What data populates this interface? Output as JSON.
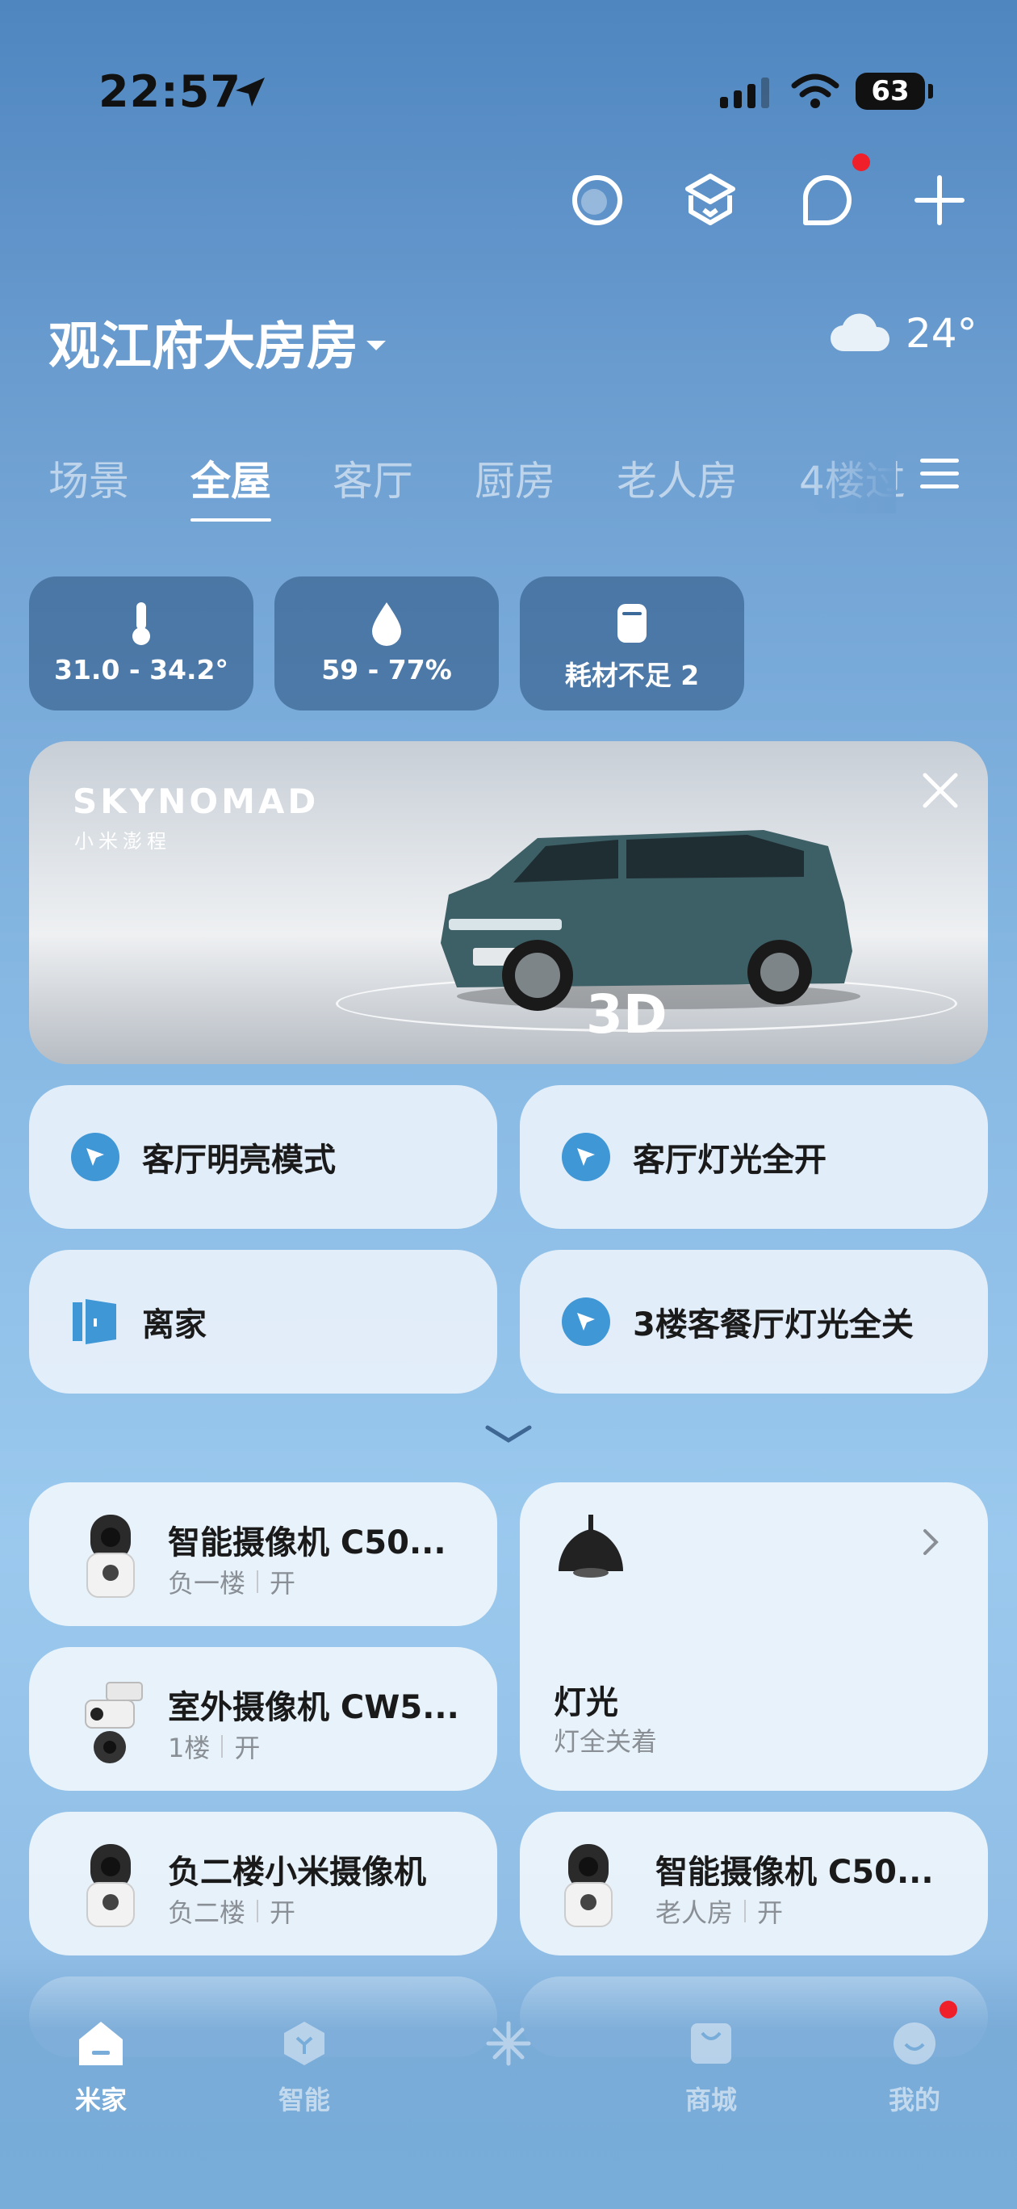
{
  "status_bar": {
    "time": "22:57",
    "battery": "63"
  },
  "header": {
    "home_name": "观江府大房房",
    "weather_temp": "24°"
  },
  "tabs": [
    {
      "label": "场景",
      "active": false
    },
    {
      "label": "全屋",
      "active": true
    },
    {
      "label": "客厅",
      "active": false
    },
    {
      "label": "厨房",
      "active": false
    },
    {
      "label": "老人房",
      "active": false
    },
    {
      "label": "4楼过",
      "active": false
    }
  ],
  "stats": [
    {
      "icon": "thermometer-icon",
      "value": "31.0 - 34.2°"
    },
    {
      "icon": "humidity-drop-icon",
      "value": "59 - 77%"
    },
    {
      "icon": "consumable-icon",
      "value": "耗材不足 2"
    }
  ],
  "banner": {
    "brand": "SKYNOMAD",
    "subtitle": "小米澎程",
    "badge": "3D"
  },
  "scenes": [
    {
      "label": "客厅明亮模式",
      "icon": "cursor-click-icon"
    },
    {
      "label": "客厅灯光全开",
      "icon": "cursor-click-icon"
    },
    {
      "label": "离家",
      "icon": "door-icon"
    },
    {
      "label": "3楼客餐厅灯光全关",
      "icon": "cursor-click-icon"
    }
  ],
  "devices": [
    {
      "name": "智能摄像机 C50...",
      "room": "负一楼",
      "state": "开"
    },
    {
      "name": "室外摄像机 CW5...",
      "room": "1楼",
      "state": "开"
    },
    {
      "name": "负二楼小米摄像机",
      "room": "负二楼",
      "state": "开"
    },
    {
      "name": "智能摄像机 C50...",
      "room": "老人房",
      "state": "开"
    }
  ],
  "light_card": {
    "name": "灯光",
    "status": "灯全关着"
  },
  "nav": [
    {
      "label": "米家",
      "active": true
    },
    {
      "label": "智能",
      "active": false
    },
    {
      "label": "",
      "active": false
    },
    {
      "label": "商城",
      "active": false
    },
    {
      "label": "我的",
      "active": false
    }
  ],
  "colors": {
    "accent_blue": "#3f97d6",
    "notification_red": "#f0202a"
  }
}
